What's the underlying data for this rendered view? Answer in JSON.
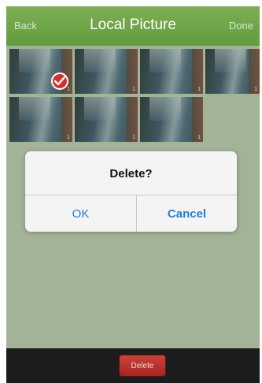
{
  "navbar": {
    "back_label": "Back",
    "title": "Local Picture",
    "done_label": "Done"
  },
  "photos": [
    {
      "selected": true,
      "index": "1"
    },
    {
      "selected": false,
      "index": "1"
    },
    {
      "selected": false,
      "index": "1"
    },
    {
      "selected": false,
      "index": "1"
    },
    {
      "selected": false,
      "index": "1"
    },
    {
      "selected": false,
      "index": "1"
    },
    {
      "selected": false,
      "index": "1"
    }
  ],
  "selection_icon": "check-circle-icon",
  "toolbar": {
    "delete_label": "Delete"
  },
  "alert": {
    "title": "Delete?",
    "ok_label": "OK",
    "cancel_label": "Cancel"
  },
  "colors": {
    "navbar_green": "#6aa546",
    "content_bg": "#bfceb2",
    "alert_button_blue": "#2b7cd3",
    "delete_red": "#b8332c",
    "badge_red": "#d2312f"
  }
}
